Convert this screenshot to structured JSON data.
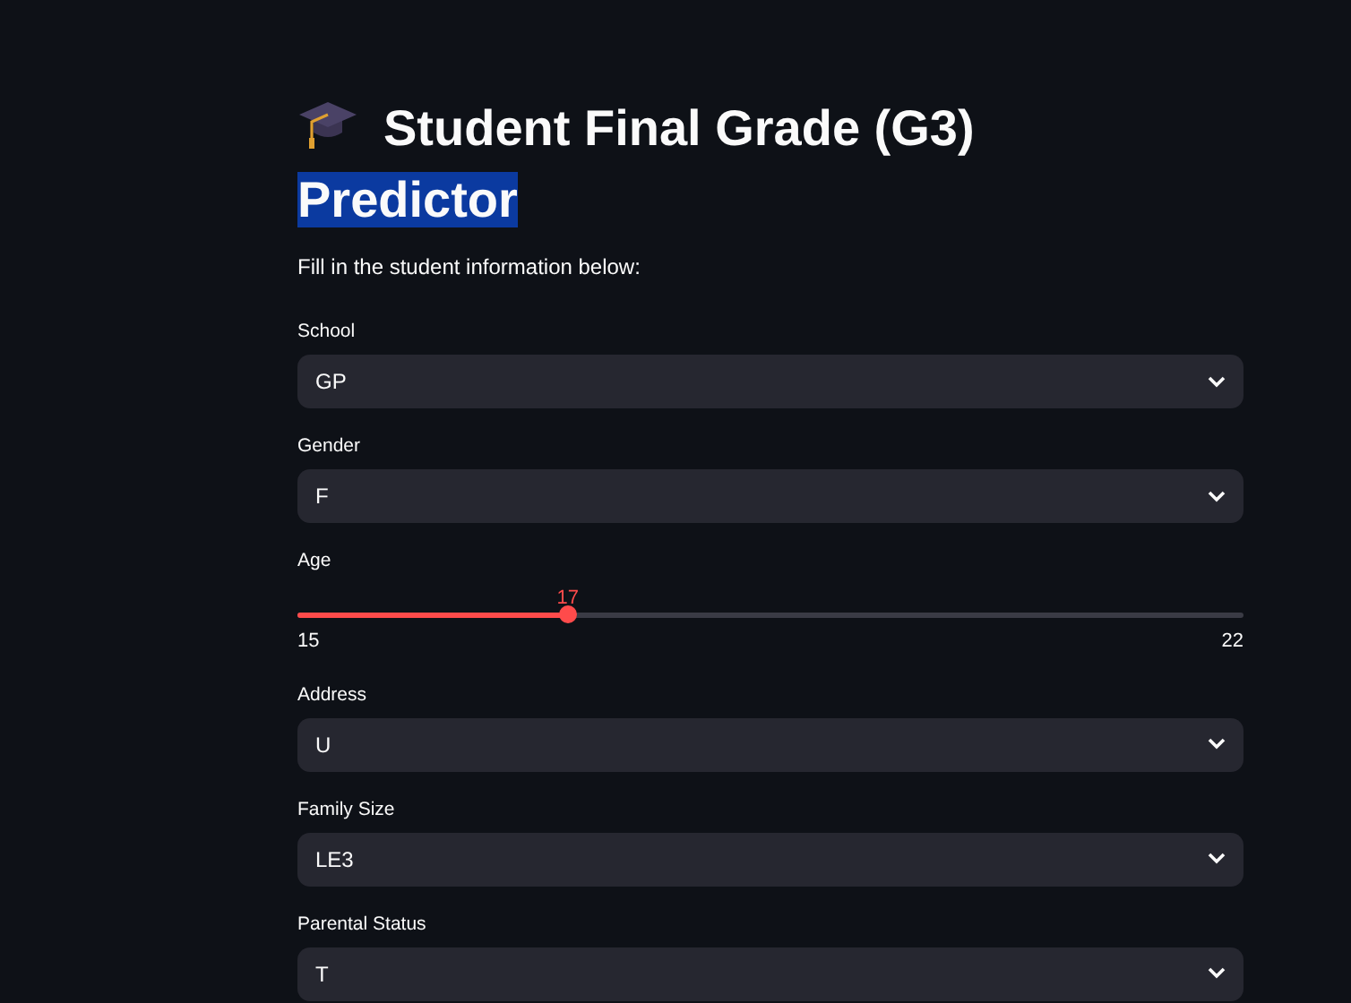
{
  "title_parts": [
    {
      "text": "Student Final Grade (G3) ",
      "selected": false
    },
    {
      "text": "Predictor",
      "selected": true
    }
  ],
  "intro": "Fill in the student information below:",
  "fields": [
    {
      "kind": "select",
      "label": "School",
      "value": "GP"
    },
    {
      "kind": "select",
      "label": "Gender",
      "value": "F"
    },
    {
      "kind": "slider",
      "label": "Age",
      "reading": "17",
      "min": "15",
      "max": "22",
      "level": 0.2857
    },
    {
      "kind": "select",
      "label": "Address",
      "value": "U"
    },
    {
      "kind": "select",
      "label": "Family Size",
      "value": "LE3"
    },
    {
      "kind": "select",
      "label": "Parental Status",
      "value": "T"
    }
  ]
}
